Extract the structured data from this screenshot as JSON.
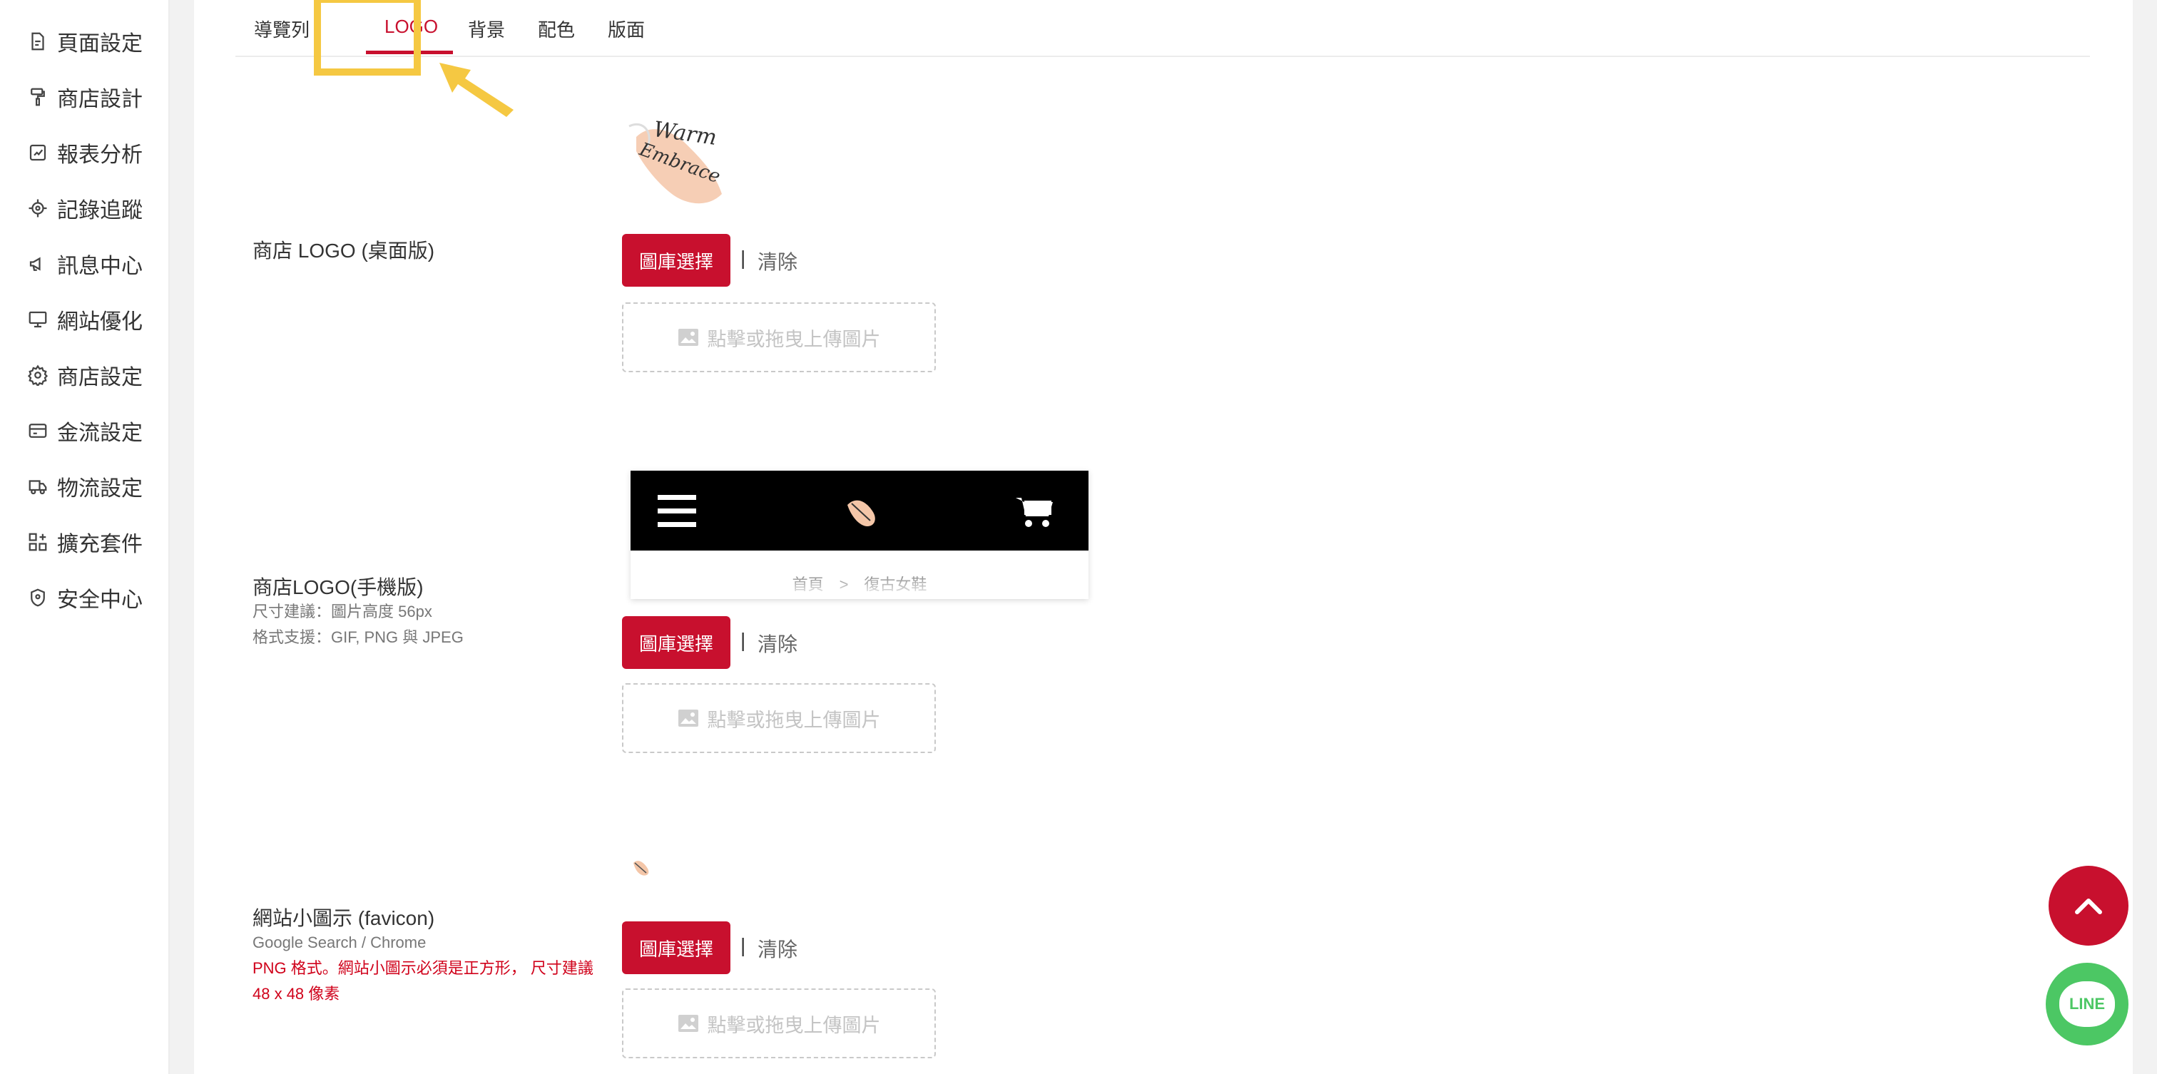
{
  "sidebar": {
    "items": [
      {
        "label": "頁面設定",
        "icon": "page-icon"
      },
      {
        "label": "商店設計",
        "icon": "brush-icon"
      },
      {
        "label": "報表分析",
        "icon": "chart-icon"
      },
      {
        "label": "記錄追蹤",
        "icon": "target-icon"
      },
      {
        "label": "訊息中心",
        "icon": "megaphone-icon"
      },
      {
        "label": "網站優化",
        "icon": "monitor-icon"
      },
      {
        "label": "商店設定",
        "icon": "gear-icon"
      },
      {
        "label": "金流設定",
        "icon": "card-icon"
      },
      {
        "label": "物流設定",
        "icon": "truck-icon"
      },
      {
        "label": "擴充套件",
        "icon": "grid-plus-icon"
      },
      {
        "label": "安全中心",
        "icon": "shield-icon"
      }
    ]
  },
  "tabs": [
    {
      "label": "導覽列",
      "active": false
    },
    {
      "label": "LOGO",
      "active": true
    },
    {
      "label": "背景",
      "active": false
    },
    {
      "label": "配色",
      "active": false
    },
    {
      "label": "版面",
      "active": false
    }
  ],
  "sections": {
    "desktop": {
      "label": "商店 LOGO (桌面版)",
      "choose_button": "圖庫選擇",
      "separator": "|",
      "clear": "清除",
      "dropzone": "點擊或拖曳上傳圖片",
      "logo_text_1": "Warm",
      "logo_text_2": "Embrace"
    },
    "mobile": {
      "label": "商店LOGO(手機版)",
      "hint_size": "尺寸建議：圖片高度 56px",
      "hint_format": "格式支援：GIF, PNG 與 JPEG",
      "choose_button": "圖庫選擇",
      "separator": "|",
      "clear": "清除",
      "dropzone": "點擊或拖曳上傳圖片",
      "breadcrumb": "首頁　>　復古女鞋"
    },
    "favicon": {
      "label": "網站小圖示 (favicon)",
      "hint": "Google Search / Chrome",
      "warning": "PNG 格式。網站小圖示必須是正方形， 尺寸建議 48 x 48 像素",
      "choose_button": "圖庫選擇",
      "separator": "|",
      "clear": "清除",
      "dropzone": "點擊或拖曳上傳圖片"
    }
  },
  "floating": {
    "line_label": "LINE"
  },
  "colors": {
    "accent": "#c8102e",
    "highlight": "#f5c842",
    "line_green": "#4cc764"
  }
}
